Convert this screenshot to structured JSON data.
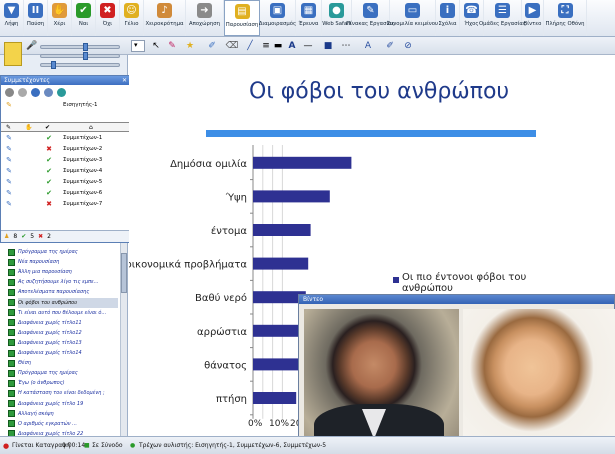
{
  "toolbar": [
    {
      "label": "Λήψη",
      "color": "#3a6fc0",
      "icon": "arrow-down-icon",
      "glyph": "▼"
    },
    {
      "label": "Παύση",
      "color": "#3a6fc0",
      "icon": "pause-icon",
      "glyph": "II"
    },
    {
      "label": "Χέρι",
      "color": "#e09a3a",
      "icon": "hand-icon",
      "glyph": "✋"
    },
    {
      "label": "Ναι",
      "color": "#2a9a2a",
      "icon": "check-icon",
      "glyph": "✔"
    },
    {
      "label": "Όχι",
      "color": "#d02020",
      "icon": "cross-icon",
      "glyph": "✖"
    },
    {
      "label": "Γέλιο",
      "color": "#e0b020",
      "icon": "smile-icon",
      "glyph": "☺"
    },
    {
      "label": "Χειροκρότημα",
      "color": "#d08a3a",
      "icon": "applause-icon",
      "glyph": "♪"
    },
    {
      "label": "Αποχώρηση",
      "color": "#8a8a8a",
      "icon": "exit-icon",
      "glyph": "➜"
    },
    {
      "label": "Παρουσίαση",
      "color": "#e0b020",
      "icon": "presentation-icon",
      "glyph": "▤"
    },
    {
      "label": "Διαμοιρασμός",
      "color": "#3a6fc0",
      "icon": "share-icon",
      "glyph": "▣"
    },
    {
      "label": "Έρευνα",
      "color": "#3a6fc0",
      "icon": "survey-icon",
      "glyph": "▦"
    },
    {
      "label": "Web Safari",
      "color": "#2a9a9a",
      "icon": "globe-icon",
      "glyph": "●"
    },
    {
      "label": "Πίνακας Εργασίας",
      "color": "#3a6fc0",
      "icon": "whiteboard-icon",
      "glyph": "✎"
    },
    {
      "label": "Συνομιλία κειμένου",
      "color": "#3a6fc0",
      "icon": "chat-icon",
      "glyph": "▭"
    },
    {
      "label": "Σχόλια",
      "color": "#3a6fc0",
      "icon": "info-icon",
      "glyph": "i"
    },
    {
      "label": "Ήχος",
      "color": "#3a6fc0",
      "icon": "phone-icon",
      "glyph": "☎"
    },
    {
      "label": "Ομάδες Εργασίας",
      "color": "#3a6fc0",
      "icon": "groups-icon",
      "glyph": "☰"
    },
    {
      "label": "Βίντεο",
      "color": "#3a6fc0",
      "icon": "video-icon",
      "glyph": "▶"
    },
    {
      "label": "Πλήρης Οθόνη",
      "color": "#3a6fc0",
      "icon": "fullscreen-icon",
      "glyph": "⛶"
    }
  ],
  "panel": {
    "title": "Συμμετέχοντες",
    "presenter": "Εισηγητής-1",
    "participants": [
      {
        "name": "Συμμετέχων-1",
        "status": "yes"
      },
      {
        "name": "Συμμετέχων-2",
        "status": "no"
      },
      {
        "name": "Συμμετέχων-3",
        "status": "yes"
      },
      {
        "name": "Συμμετέχων-4",
        "status": "yes"
      },
      {
        "name": "Συμμετέχων-5",
        "status": "yes"
      },
      {
        "name": "Συμμετέχων-6",
        "status": "yes"
      },
      {
        "name": "Συμμετέχων-7",
        "status": "no"
      }
    ],
    "count_total": "8",
    "count_yes": "5",
    "count_no": "2"
  },
  "slides": [
    "Πρόγραμμα της ημέρας",
    "Νέα παρουσίαση",
    "Άλλη μια παρουσίαση",
    "Ας συζητήσουμε λίγο τις εμπε...",
    "Αποτελέσματα παρουσίασης",
    "Οι φόβοι του ανθρώπου",
    "Τι είναι αυτό που θέλουμε είναι ό...",
    "Διαφάνεια χωρίς τίτλο11",
    "Διαφάνεια χωρίς τίτλο12",
    "Διαφάνεια χωρίς τίτλο13",
    "Διαφάνεια χωρίς τίτλο14",
    "Θέση",
    "Πρόγραμμα της ημέρας",
    "Έγω (ο άνθρωπος)",
    "Η κατάσταση του είναι δεδομένη ;",
    "Διαφάνεια χωρίς τίτλο 19",
    "Αλλαγή σκέψη",
    "Ο αριθμός εγκρατών ...",
    "Διαφάνεια χωρίς τίτλο 22"
  ],
  "selected_slide": 5,
  "slide": {
    "title": "Οι φόβοι του ανθρώπου"
  },
  "chart_data": {
    "type": "bar",
    "orientation": "horizontal",
    "categories": [
      "Δημόσια ομιλία",
      "Ύψη",
      "έντομα",
      "οικονομικά προβλήματα",
      "Βαθύ νερό",
      "αρρώστια",
      "θάνατος",
      "πτήση"
    ],
    "series": [
      {
        "name": "Οι πιο έντονοι φόβοι του ανθρώπου",
        "values": [
          41,
          32,
          24,
          23,
          22,
          20,
          19,
          18
        ]
      }
    ],
    "xticks": [
      "0%",
      "10%",
      "20%"
    ],
    "xlim": [
      0,
      100
    ],
    "grid": true,
    "legend": "right",
    "bar_color": "#2e3192"
  },
  "video": {
    "title": "Βίντεο"
  },
  "status": {
    "state": "Γίνεται Καταγραφή",
    "time": "0:00:14",
    "sync": "Σε Σύνοδο",
    "users": "Τρέχων αυλιστής: Εισηγητής-1, Συμμετέχων-6, Συμμετέχων-5"
  }
}
